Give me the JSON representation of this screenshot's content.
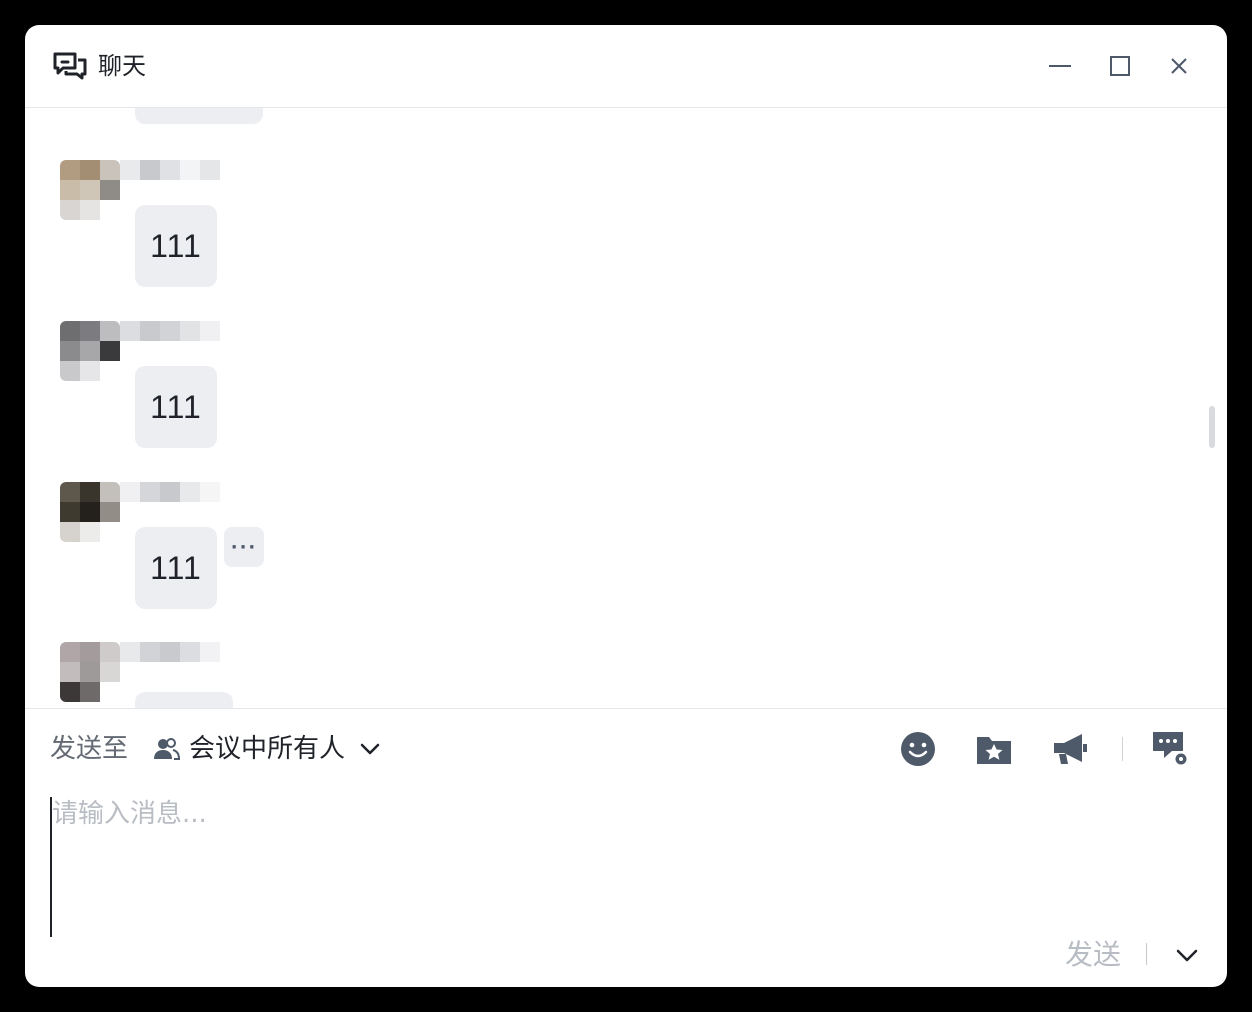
{
  "window": {
    "title": "聊天"
  },
  "messages": [
    {
      "text": "111",
      "avatar_colors": [
        "#b19c82",
        "#a38e73",
        "#c9c3bb",
        "#c9bca9",
        "#cfc6b8",
        "#8f8c87",
        "#d8d5d2",
        "#e6e4e2",
        "#ffffff"
      ],
      "name_colors": [
        "#e9eaec",
        "#c7c9cd",
        "#dfe1e4",
        "#f3f4f5",
        "#e4e6e8"
      ],
      "has_more": false
    },
    {
      "text": "111",
      "avatar_colors": [
        "#6e6e70",
        "#7c7c80",
        "#bdbdc0",
        "#8b8b8e",
        "#a7a7aa",
        "#3a3a3c",
        "#c9c9cc",
        "#e6e6e8",
        "#ffffff"
      ],
      "name_colors": [
        "#dcdde0",
        "#c9cacd",
        "#d2d3d6",
        "#e2e3e5",
        "#f0f0f2"
      ],
      "has_more": false
    },
    {
      "text": "111",
      "avatar_colors": [
        "#5d574c",
        "#3a352c",
        "#c3c0bb",
        "#3f3a30",
        "#24211c",
        "#928d86",
        "#d6d3cf",
        "#ececea",
        "#ffffff"
      ],
      "name_colors": [
        "#f0f0f2",
        "#d5d6d9",
        "#c8c9cc",
        "#e8e9eb",
        "#f5f5f6"
      ],
      "has_more": true
    },
    {
      "text": "",
      "avatar_colors": [
        "#b0a6a8",
        "#a39b9c",
        "#cfcbcb",
        "#c2bcbc",
        "#9e9a9a",
        "#d9d6d6",
        "#3d3838",
        "#6f6a6a",
        "#ffffff"
      ],
      "name_colors": [
        "#e8e9eb",
        "#d2d3d6",
        "#c9cacd",
        "#dcdde0",
        "#f2f2f4"
      ],
      "has_more": false
    }
  ],
  "composer": {
    "send_to_label": "发送至",
    "target": "会议中所有人",
    "placeholder": "请输入消息...",
    "send_label": "发送"
  },
  "icons": {
    "title": "chat-bubbles-icon",
    "minimize": "minimize-icon",
    "maximize": "maximize-icon",
    "close": "close-icon",
    "people": "people-icon",
    "emoji": "emoji-icon",
    "folder": "folder-star-icon",
    "announce": "megaphone-icon",
    "chat_settings": "chat-settings-icon"
  },
  "colors": {
    "bubble": "#eceef2",
    "icon": "#4e5969",
    "muted": "#b8bcc3"
  }
}
